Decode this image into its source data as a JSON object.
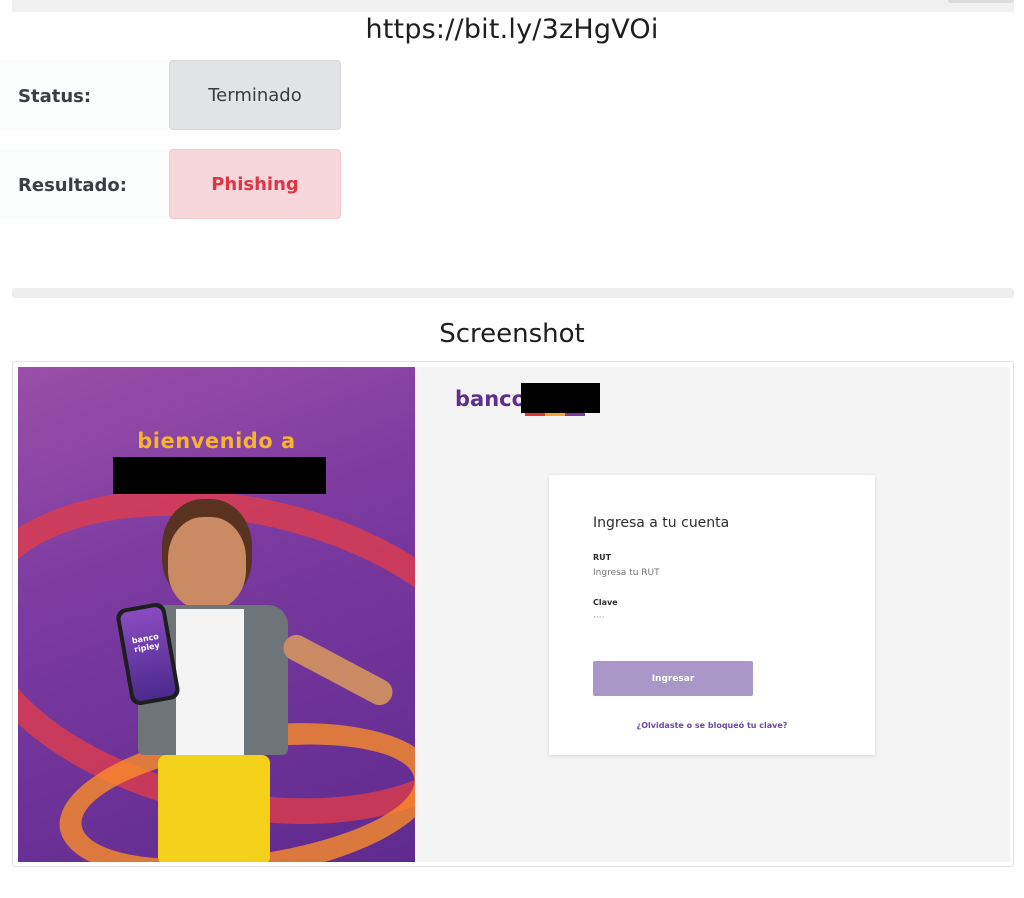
{
  "header": {
    "url": "https://bit.ly/3zHgVOi"
  },
  "status": {
    "label": "Status:",
    "value": "Terminado"
  },
  "result": {
    "label": "Resultado:",
    "value": "Phishing"
  },
  "screenshot": {
    "title": "Screenshot",
    "promo": {
      "welcome": "bienvenido a",
      "phone_brand_line1": "banco",
      "phone_brand_line2": "ripley"
    },
    "brand": {
      "text": "banco",
      "bar_colors": [
        "#e2333b",
        "#f6a623",
        "#7b3aa0"
      ]
    },
    "login": {
      "title": "Ingresa a tu cuenta",
      "rut_label": "RUT",
      "rut_placeholder": "Ingresa tu RUT",
      "clave_label": "Clave",
      "clave_placeholder": "····",
      "submit_label": "Ingresar",
      "forgot_link": "¿Olvidaste o se bloqueó tu clave?"
    }
  },
  "colors": {
    "status_bg": "#e2e3e5",
    "phishing_bg": "#f8d7da",
    "phishing_text": "#dc3545",
    "brand_purple": "#5d2f8e",
    "button_bg": "#a897c7"
  }
}
